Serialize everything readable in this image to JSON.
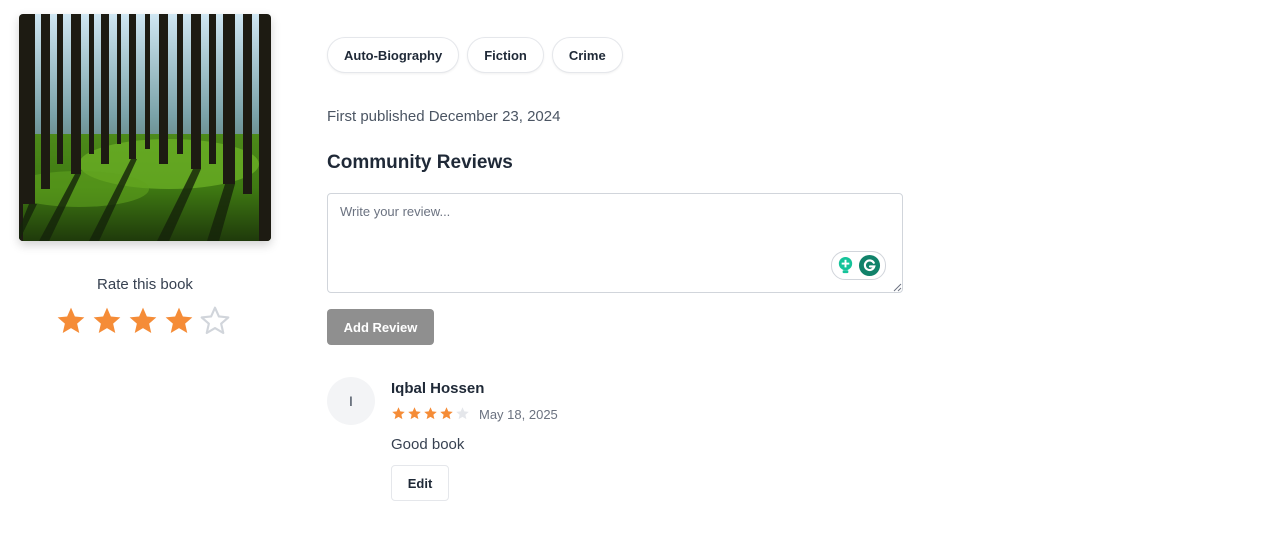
{
  "book": {
    "truncated_description": "",
    "genres": [
      "Auto-Biography",
      "Fiction",
      "Crime"
    ],
    "published": "First published December 23, 2024"
  },
  "rating": {
    "label": "Rate this book",
    "value": 4,
    "max": 5,
    "filled_color": "#f58c37",
    "empty_color": "#d1d5db"
  },
  "reviews_section": {
    "title": "Community Reviews",
    "placeholder": "Write your review...",
    "add_button": "Add Review"
  },
  "reviews": [
    {
      "avatar_initial": "I",
      "name": "Iqbal Hossen",
      "rating": 4,
      "date": "May 18, 2025",
      "text": "Good book",
      "edit_label": "Edit"
    }
  ],
  "icons": {
    "grammarly_suggest": "lightbulb-plus-icon",
    "grammarly_logo": "grammarly-icon"
  }
}
